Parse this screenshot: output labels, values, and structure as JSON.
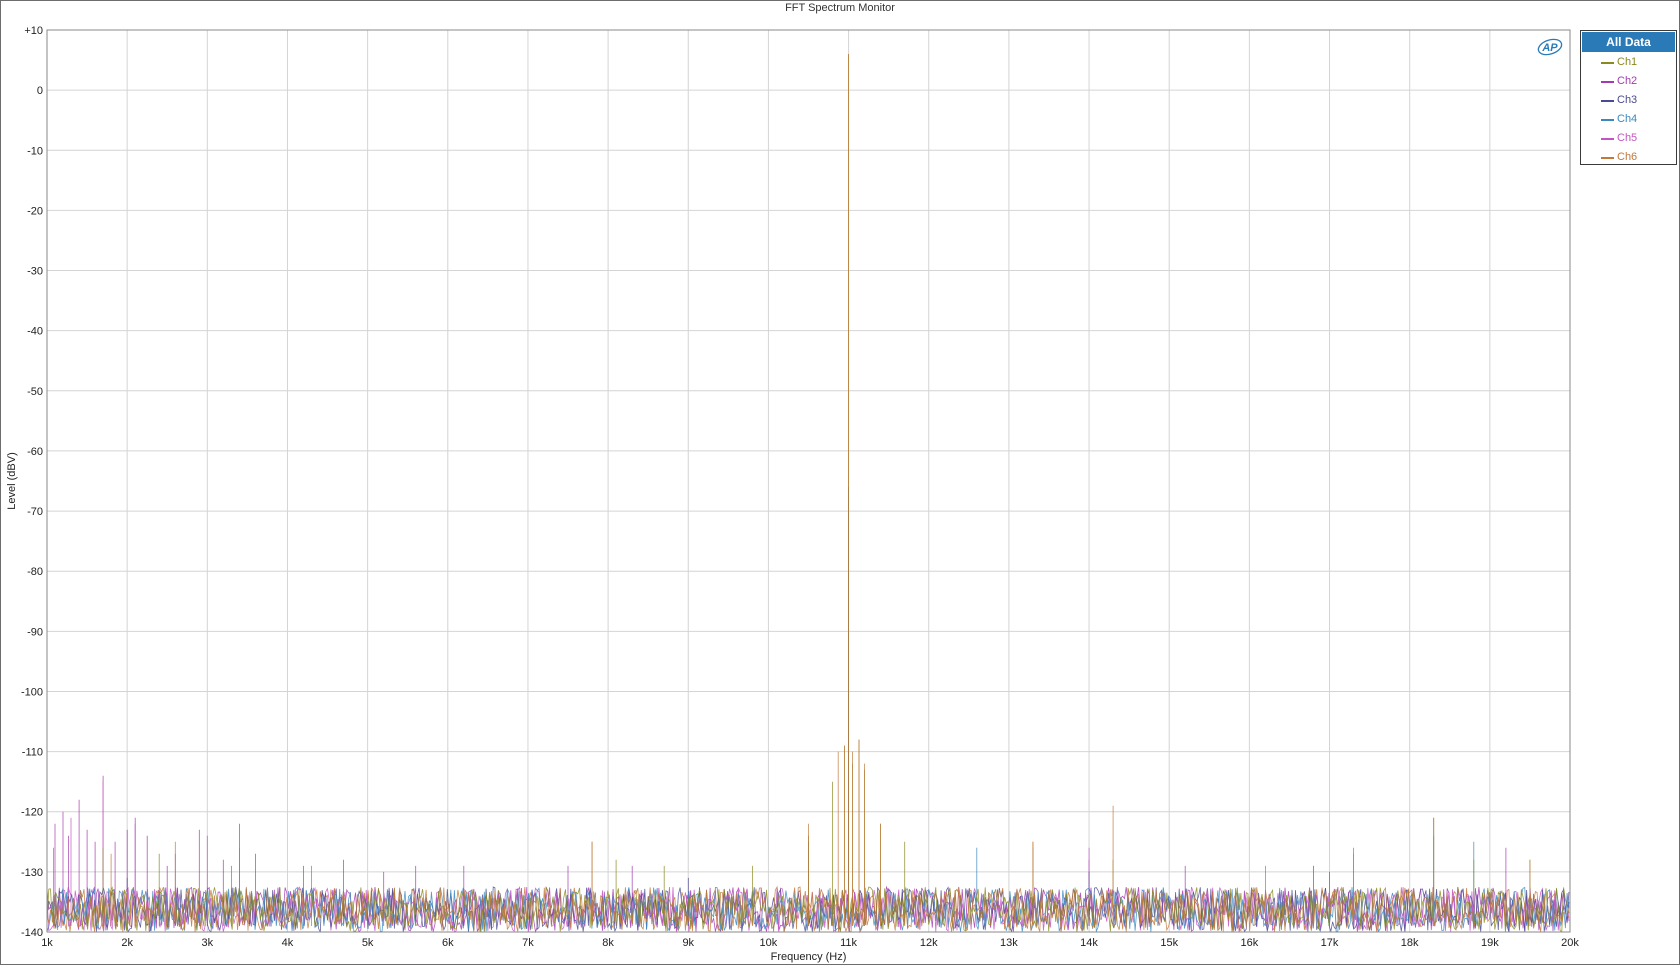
{
  "chart_data": {
    "type": "line",
    "title": "FFT Spectrum Monitor",
    "xlabel": "Frequency (Hz)",
    "ylabel": "Level (dBV)",
    "xlim": [
      1000,
      20000
    ],
    "ylim": [
      -140,
      10
    ],
    "x_ticks": [
      {
        "value": 1000,
        "label": "1k"
      },
      {
        "value": 2000,
        "label": "2k"
      },
      {
        "value": 3000,
        "label": "3k"
      },
      {
        "value": 4000,
        "label": "4k"
      },
      {
        "value": 5000,
        "label": "5k"
      },
      {
        "value": 6000,
        "label": "6k"
      },
      {
        "value": 7000,
        "label": "7k"
      },
      {
        "value": 8000,
        "label": "8k"
      },
      {
        "value": 9000,
        "label": "9k"
      },
      {
        "value": 10000,
        "label": "10k"
      },
      {
        "value": 11000,
        "label": "11k"
      },
      {
        "value": 12000,
        "label": "12k"
      },
      {
        "value": 13000,
        "label": "13k"
      },
      {
        "value": 14000,
        "label": "14k"
      },
      {
        "value": 15000,
        "label": "15k"
      },
      {
        "value": 16000,
        "label": "16k"
      },
      {
        "value": 17000,
        "label": "17k"
      },
      {
        "value": 18000,
        "label": "18k"
      },
      {
        "value": 19000,
        "label": "19k"
      },
      {
        "value": 20000,
        "label": "20k"
      }
    ],
    "y_ticks": [
      {
        "value": 10,
        "label": "+10"
      },
      {
        "value": 0,
        "label": "0"
      },
      {
        "value": -10,
        "label": "-10"
      },
      {
        "value": -20,
        "label": "-20"
      },
      {
        "value": -30,
        "label": "-30"
      },
      {
        "value": -40,
        "label": "-40"
      },
      {
        "value": -50,
        "label": "-50"
      },
      {
        "value": -60,
        "label": "-60"
      },
      {
        "value": -70,
        "label": "-70"
      },
      {
        "value": -80,
        "label": "-80"
      },
      {
        "value": -90,
        "label": "-90"
      },
      {
        "value": -100,
        "label": "-100"
      },
      {
        "value": -110,
        "label": "-110"
      },
      {
        "value": -120,
        "label": "-120"
      },
      {
        "value": -130,
        "label": "-130"
      },
      {
        "value": -140,
        "label": "-140"
      }
    ],
    "grid": true,
    "legend": {
      "title": "All Data",
      "placement": "right"
    },
    "noise_floor_db": [
      -140,
      -134
    ],
    "series": [
      {
        "name": "Ch1",
        "color": "#8a8a1e",
        "points": [
          [
            1000,
            -136
          ],
          [
            1080,
            -126
          ],
          [
            1700,
            -126
          ],
          [
            2400,
            -127
          ],
          [
            3400,
            -126
          ],
          [
            4300,
            -129
          ],
          [
            7800,
            -125
          ],
          [
            8100,
            -128
          ],
          [
            8700,
            -129
          ],
          [
            9800,
            -129
          ],
          [
            10500,
            -124
          ],
          [
            10800,
            -115
          ],
          [
            10950,
            -109
          ],
          [
            11000,
            6
          ],
          [
            11050,
            -112
          ],
          [
            11130,
            -108
          ],
          [
            11200,
            -113
          ],
          [
            11400,
            -122
          ],
          [
            11700,
            -125
          ],
          [
            13300,
            -125
          ],
          [
            14300,
            -128
          ],
          [
            16200,
            -129
          ],
          [
            16800,
            -129
          ],
          [
            17300,
            -126
          ],
          [
            18300,
            -121
          ],
          [
            18800,
            -128
          ],
          [
            19500,
            -128
          ],
          [
            20000,
            -135
          ]
        ]
      },
      {
        "name": "Ch2",
        "color": "#a33ab0",
        "points": [
          [
            1000,
            -133
          ],
          [
            1100,
            -122
          ],
          [
            1200,
            -120
          ],
          [
            1270,
            -124
          ],
          [
            1400,
            -118
          ],
          [
            1500,
            -123
          ],
          [
            1600,
            -125
          ],
          [
            1700,
            -114
          ],
          [
            1850,
            -125
          ],
          [
            2000,
            -123
          ],
          [
            2100,
            -121
          ],
          [
            2250,
            -124
          ],
          [
            2500,
            -129
          ],
          [
            2600,
            -127
          ],
          [
            2900,
            -123
          ],
          [
            3200,
            -128
          ],
          [
            3400,
            -122
          ],
          [
            3600,
            -127
          ],
          [
            4200,
            -129
          ],
          [
            4700,
            -128
          ],
          [
            5200,
            -130
          ],
          [
            5600,
            -129
          ],
          [
            6200,
            -129
          ],
          [
            7500,
            -129
          ],
          [
            8300,
            -129
          ],
          [
            14000,
            -128
          ],
          [
            15200,
            -129
          ],
          [
            17000,
            -130
          ],
          [
            19200,
            -126
          ],
          [
            20000,
            -134
          ]
        ]
      },
      {
        "name": "Ch3",
        "color": "#4a4a90",
        "points": [
          [
            1000,
            -136
          ],
          [
            2000,
            -131
          ],
          [
            9000,
            -131
          ],
          [
            11000,
            -66
          ],
          [
            14000,
            -130
          ],
          [
            20000,
            -136
          ]
        ]
      },
      {
        "name": "Ch4",
        "color": "#3a88c0",
        "points": [
          [
            1000,
            -136
          ],
          [
            3300,
            -129
          ],
          [
            10500,
            -125
          ],
          [
            11000,
            -66
          ],
          [
            12600,
            -126
          ],
          [
            13300,
            -126
          ],
          [
            18300,
            -124
          ],
          [
            18800,
            -125
          ],
          [
            20000,
            -136
          ]
        ]
      },
      {
        "name": "Ch5",
        "color": "#c454c2",
        "points": [
          [
            1000,
            -134
          ],
          [
            1300,
            -121
          ],
          [
            1700,
            -115
          ],
          [
            2100,
            -122
          ],
          [
            3000,
            -124
          ],
          [
            11000,
            -70
          ],
          [
            14000,
            -126
          ],
          [
            20000,
            -134
          ]
        ]
      },
      {
        "name": "Ch6",
        "color": "#c2783a",
        "points": [
          [
            1000,
            -137
          ],
          [
            1800,
            -127
          ],
          [
            2600,
            -125
          ],
          [
            7800,
            -125
          ],
          [
            10500,
            -122
          ],
          [
            10870,
            -110
          ],
          [
            10950,
            -109
          ],
          [
            11000,
            6
          ],
          [
            11050,
            -110
          ],
          [
            11130,
            -108
          ],
          [
            11200,
            -112
          ],
          [
            11400,
            -122
          ],
          [
            13300,
            -125
          ],
          [
            14300,
            -119
          ],
          [
            16800,
            -129
          ],
          [
            17300,
            -127
          ],
          [
            18300,
            -121
          ],
          [
            19500,
            -128
          ],
          [
            20000,
            -137
          ]
        ]
      }
    ]
  },
  "legend": {
    "header": "All Data",
    "items": [
      {
        "label": "Ch1",
        "color": "#8a8a1e"
      },
      {
        "label": "Ch2",
        "color": "#a33ab0"
      },
      {
        "label": "Ch3",
        "color": "#4a4a90"
      },
      {
        "label": "Ch4",
        "color": "#3a88c0"
      },
      {
        "label": "Ch5",
        "color": "#c454c2"
      },
      {
        "label": "Ch6",
        "color": "#c2783a"
      }
    ]
  },
  "logo": {
    "icon": "ap-logo-icon",
    "text": "AP",
    "color": "#2a7ab8"
  }
}
